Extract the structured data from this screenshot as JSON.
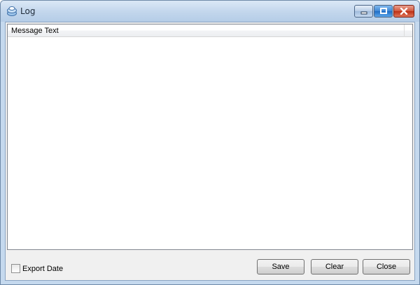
{
  "window": {
    "title": "Log"
  },
  "list": {
    "columns": [
      "Message Text"
    ]
  },
  "footer": {
    "export_date_label": "Export Date",
    "save_label": "Save",
    "clear_label": "Clear",
    "close_label": "Close"
  },
  "icons": {
    "app": "log-app-icon",
    "minimize": "minimize-icon",
    "maximize": "maximize-icon",
    "close": "close-icon"
  },
  "colors": {
    "titlebar": "#c2d6ec",
    "close_button": "#c8412a",
    "maximize_button": "#2f79cc"
  }
}
